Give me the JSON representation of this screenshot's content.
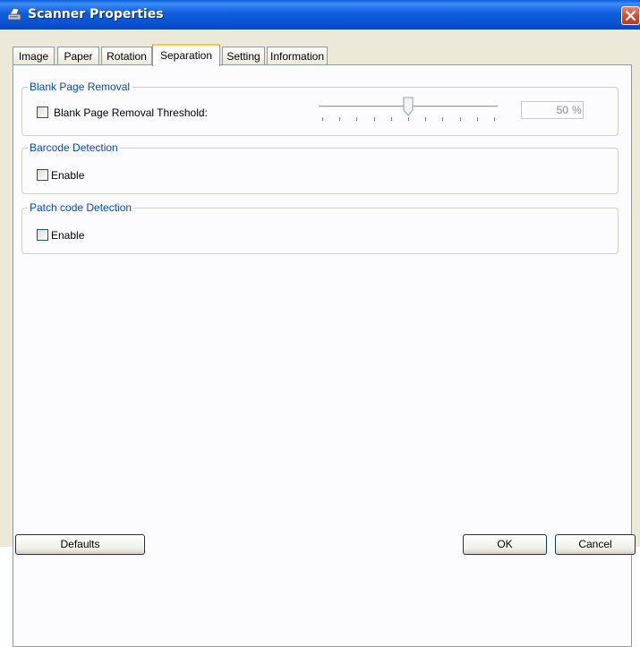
{
  "window": {
    "title": "Scanner Properties"
  },
  "tabs": [
    {
      "label": "Image"
    },
    {
      "label": "Paper"
    },
    {
      "label": "Rotation"
    },
    {
      "label": "Separation",
      "active": true
    },
    {
      "label": "Setting"
    },
    {
      "label": "Information"
    }
  ],
  "blank_page": {
    "title": "Blank Page Removal",
    "checkbox_label": "Blank Page Removal Threshold:",
    "checked": false,
    "slider_value": 50,
    "value_text": "50",
    "unit": "%"
  },
  "barcode": {
    "title": "Barcode Detection",
    "checkbox_label": "Enable",
    "checked": false
  },
  "patch": {
    "title": "Patch code Detection",
    "checkbox_label": "Enable",
    "checked": false
  },
  "buttons": {
    "defaults": "Defaults",
    "ok": "OK",
    "cancel": "Cancel"
  },
  "colors": {
    "titlebar": "#0a52d0",
    "group_title": "#0046d5",
    "active_tab_accent": "#ffc83c",
    "close": "#d2462c"
  },
  "icons": {
    "app": "scanner-icon",
    "close": "close-icon"
  }
}
